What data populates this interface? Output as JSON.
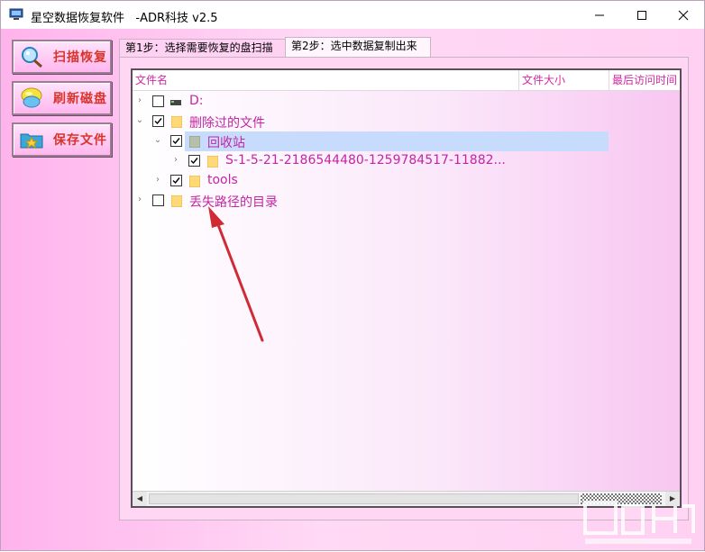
{
  "window": {
    "title": "星空数据恢复软件   -ADR科技 v2.5"
  },
  "sidebar": {
    "buttons": [
      {
        "label": "扫描恢复",
        "icon": "magnifier-icon"
      },
      {
        "label": "刷新磁盘",
        "icon": "refresh-disk-icon"
      },
      {
        "label": "保存文件",
        "icon": "save-folder-icon"
      }
    ]
  },
  "tabs": [
    {
      "label": "第1步：选择需要恢复的盘扫描",
      "active": false
    },
    {
      "label": "第2步：选中数据复制出来",
      "active": true
    }
  ],
  "tree": {
    "columns": [
      "文件名",
      "文件大小",
      "最后访问时间"
    ],
    "rows": [
      {
        "label": "D:",
        "level": 0,
        "checked": false,
        "expander": "›",
        "icon": "drive-icon"
      },
      {
        "label": "删除过的文件",
        "level": 0,
        "checked": true,
        "expander": "⌄",
        "icon": "folder-icon"
      },
      {
        "label": "回收站",
        "level": 1,
        "checked": true,
        "expander": "⌄",
        "icon": "recycle-folder-icon",
        "selected": true
      },
      {
        "label": "S-1-5-21-2186544480-1259784517-11882...",
        "level": 2,
        "checked": true,
        "expander": "›",
        "icon": "folder-icon"
      },
      {
        "label": "tools",
        "level": 1,
        "checked": true,
        "expander": "›",
        "icon": "folder-icon"
      },
      {
        "label": "丢失路径的目录",
        "level": 0,
        "checked": false,
        "expander": "›",
        "icon": "folder-icon"
      }
    ]
  },
  "scrollbar": {
    "left_arrow": "◀",
    "right_arrow": "▶"
  },
  "colors": {
    "accent_text": "#c226a3",
    "annotation_arrow": "#d02a35",
    "selection": "#c7dcfd"
  }
}
